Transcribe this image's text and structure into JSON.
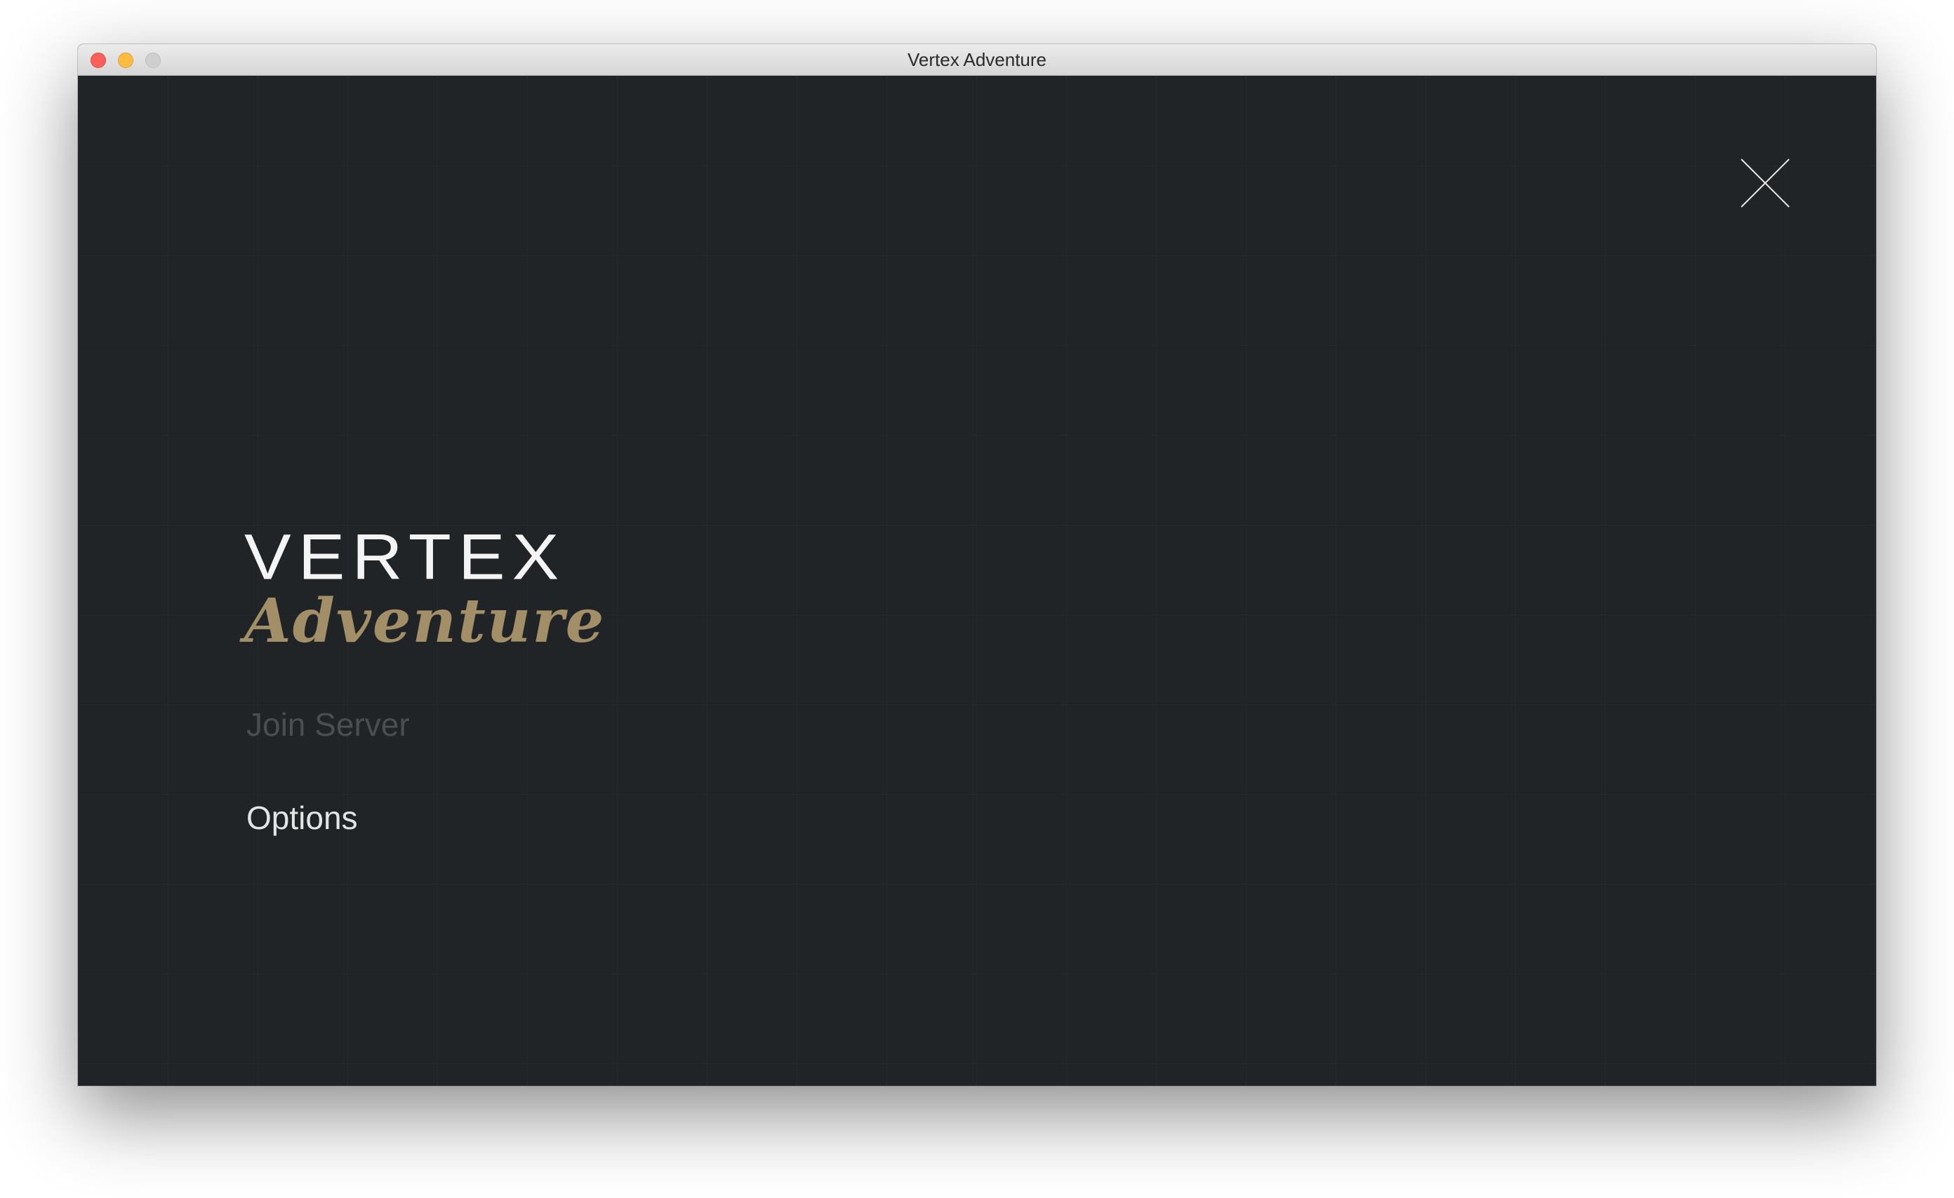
{
  "window": {
    "title": "Vertex Adventure"
  },
  "logo": {
    "line1": "VERTEX",
    "line2": "Adventure",
    "line1_color": "#f4f4f4",
    "line2_color": "#a38f67"
  },
  "menu": {
    "items": [
      {
        "label": "Join Server",
        "state": "disabled"
      },
      {
        "label": "Options",
        "state": "enabled"
      }
    ]
  },
  "close_button": {
    "icon": "close-icon"
  },
  "colors": {
    "background": "#212426",
    "accent_gold": "#a38f67"
  }
}
